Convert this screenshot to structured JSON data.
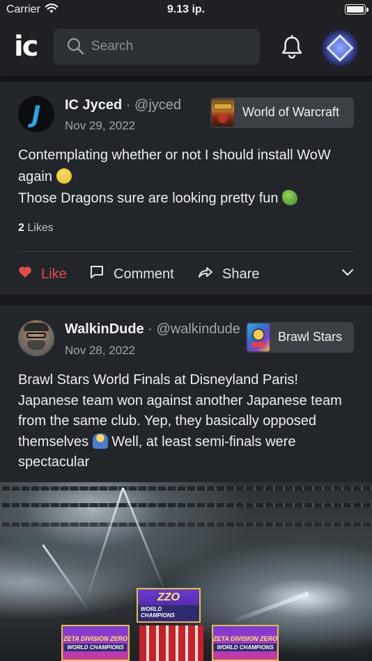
{
  "status_bar": {
    "carrier": "Carrier",
    "time": "9.13 ip."
  },
  "header": {
    "logo": "ic",
    "search_placeholder": "Search"
  },
  "posts": [
    {
      "author": "IC Jyced",
      "handle": "· @jyced",
      "date": "Nov 29, 2022",
      "game": "World of Warcraft",
      "text_line1": "Contemplating whether or not I should install WoW again",
      "text_line2": "Those Dragons sure are looking pretty fun",
      "likes_count": "2",
      "likes_label": "Likes",
      "actions": {
        "like": "Like",
        "comment": "Comment",
        "share": "Share"
      }
    },
    {
      "author": "WalkinDude",
      "handle": "· @walkindude",
      "date": "Nov 28, 2022",
      "game": "Brawl Stars",
      "text_a": "Brawl Stars World Finals at Disneyland Paris! Japanese team won against another Japanese team from the same club. Yep, they basically opposed themselves",
      "text_b": "Well, at least semi-finals were spectacular",
      "photo_screens": {
        "center_title": "WORLD CHAMPIONS",
        "left_top": "ZETA DIVISION ZERO",
        "left_bottom": "WORLD CHAMPIONS",
        "right_top": "ZETA DIVISION ZERO",
        "right_bottom": "WORLD CHAMPIONS"
      }
    }
  ],
  "colors": {
    "like_red": "#e24b4b",
    "background": "#17191d",
    "card": "#22252a",
    "tag": "#3c3f45"
  },
  "icons": [
    "wifi-icon",
    "battery-icon",
    "search-icon",
    "bell-icon",
    "heart-icon",
    "comment-icon",
    "share-icon",
    "chevron-down-icon"
  ]
}
